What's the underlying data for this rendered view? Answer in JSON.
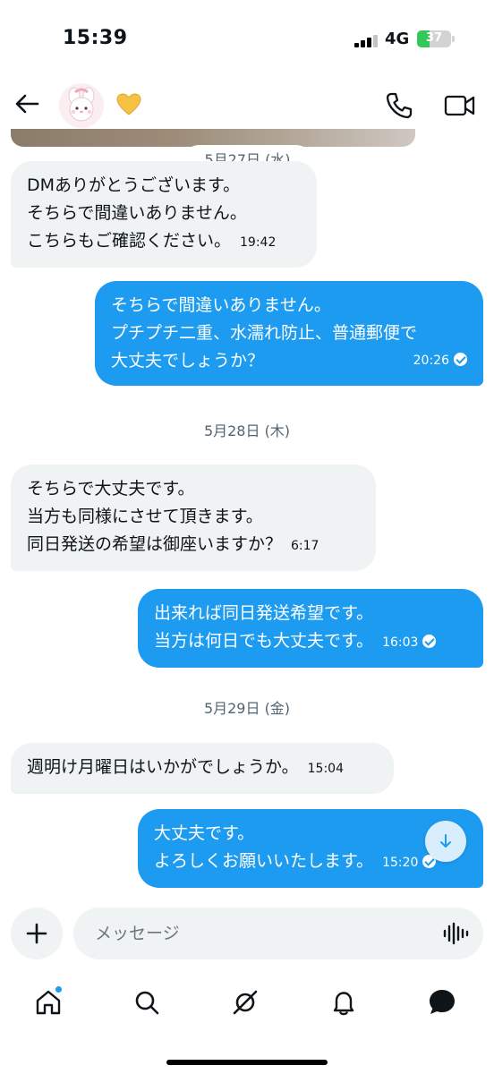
{
  "status_bar": {
    "time": "15:39",
    "network": "4G",
    "battery_percent": "37",
    "battery_level": 0.37,
    "signal_bars": 3
  },
  "header": {
    "icons": {
      "back": "arrow-left-icon",
      "avatar": "avatar",
      "heart": "yellow-heart-emoji",
      "call": "phone-icon",
      "video": "video-camera-icon"
    },
    "colors": {
      "heart": "#f6c243"
    }
  },
  "messages": [
    {
      "type": "date",
      "text": "5月27日 (水)"
    },
    {
      "type": "in",
      "text": "DMありがとうございます。\nそちらで間違いありません。\nこちらもご確認ください。",
      "time": "19:42"
    },
    {
      "type": "out",
      "text": "そちらで間違いありません。\nプチプチ二重、水濡れ防止、普通郵便で\n大丈夫でしょうか？",
      "time": "20:26",
      "read": true
    },
    {
      "type": "date",
      "text": "5月28日 (木)"
    },
    {
      "type": "in",
      "text": "そちらで大丈夫です。\n当方も同様にさせて頂きます。\n同日発送の希望は御座いますか？",
      "time": "6:17"
    },
    {
      "type": "out",
      "text": "出来れば同日発送希望です。\n当方は何日でも大丈夫です。",
      "time": "16:03",
      "read": true
    },
    {
      "type": "date",
      "text": "5月29日 (金)"
    },
    {
      "type": "in",
      "text": "週明け月曜日はいかがでしょうか。",
      "time": "15:04"
    },
    {
      "type": "out",
      "text": "大丈夫です。\nよろしくお願いいたします。",
      "time": "15:20",
      "read": true
    }
  ],
  "composer": {
    "placeholder": "メッセージ",
    "icons": {
      "add": "plus-icon",
      "voice": "voice-waveform-icon"
    }
  },
  "bottom_nav": {
    "items": [
      {
        "name": "home",
        "icon": "home-icon",
        "has_badge": true
      },
      {
        "name": "search",
        "icon": "search-icon"
      },
      {
        "name": "grok",
        "icon": "grok-icon"
      },
      {
        "name": "notifications",
        "icon": "bell-icon"
      },
      {
        "name": "messages",
        "icon": "chat-bubble-icon",
        "active": true
      }
    ]
  },
  "colors": {
    "accent": "#1d9bf0",
    "incoming_bubble": "#eff3f4",
    "text": "#0f1419",
    "secondary_text": "#536471"
  }
}
